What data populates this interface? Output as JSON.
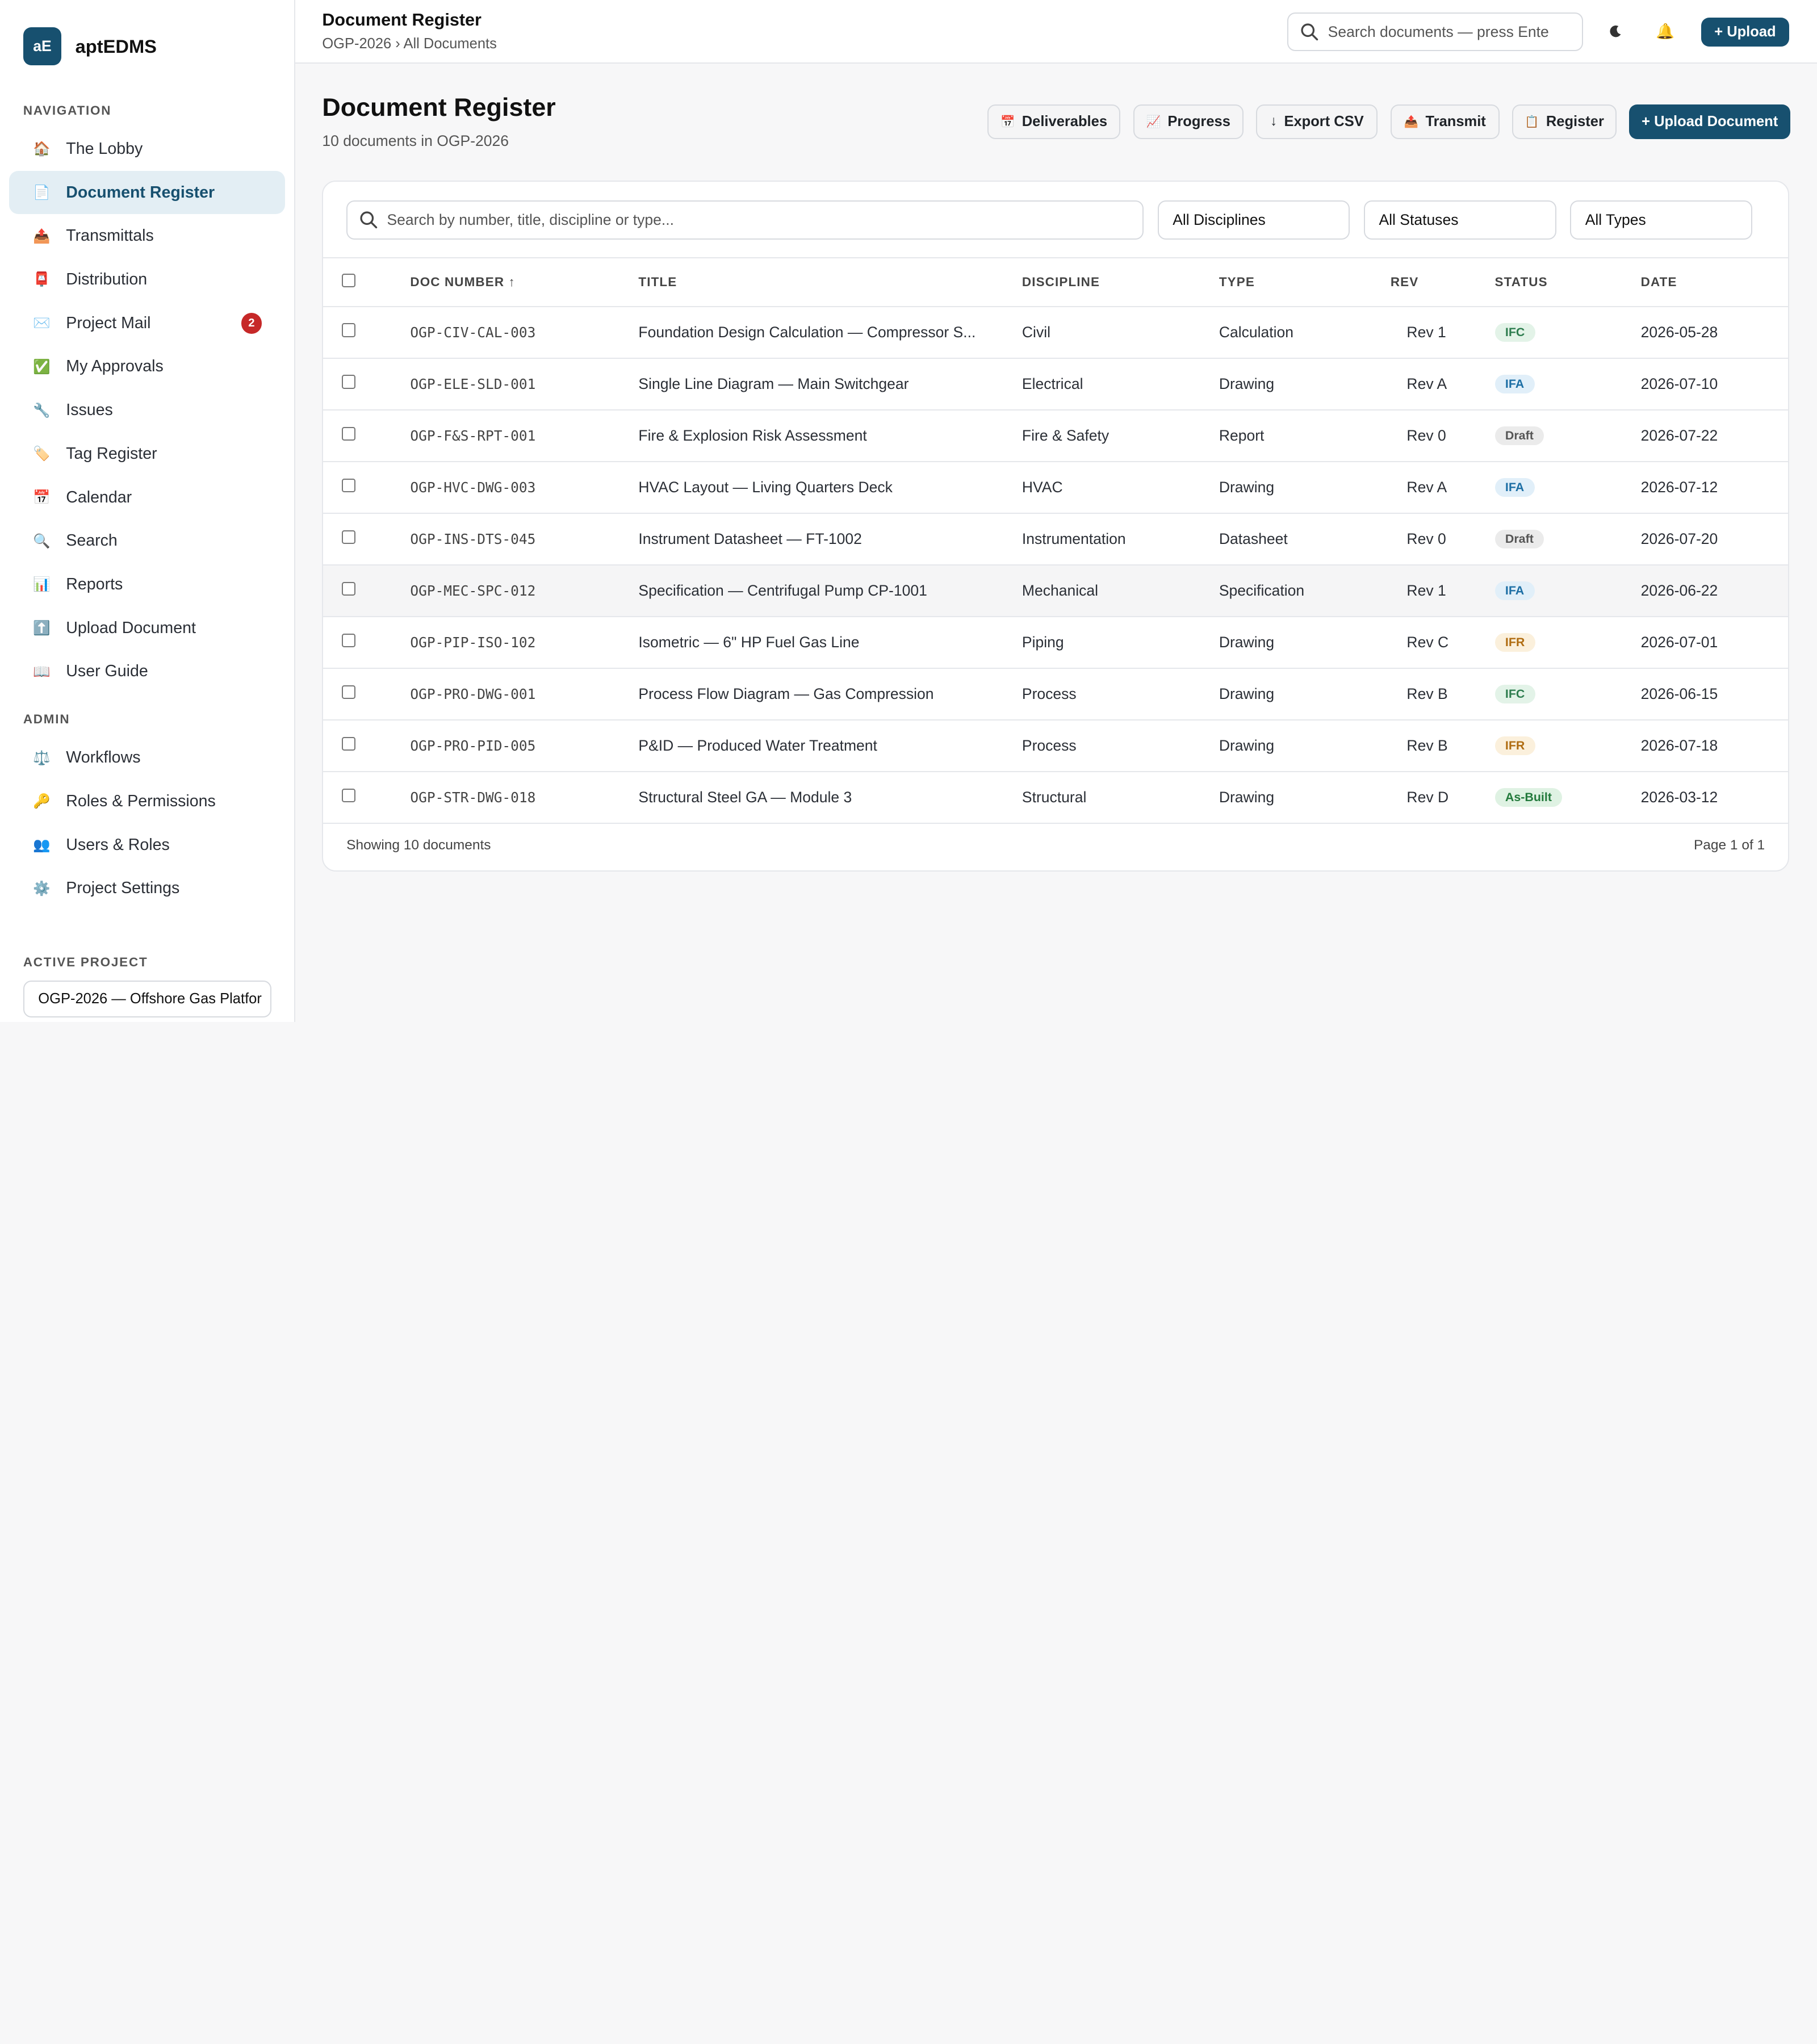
{
  "brand": {
    "logo_text": "aE",
    "name": "aptEDMS"
  },
  "sidebar": {
    "nav_heading": "NAVIGATION",
    "items": [
      {
        "label": "The Lobby",
        "icon": "🏠"
      },
      {
        "label": "Document Register",
        "icon": "📄"
      },
      {
        "label": "Transmittals",
        "icon": "📤"
      },
      {
        "label": "Distribution",
        "icon": "📮"
      },
      {
        "label": "Project Mail",
        "icon": "✉️",
        "badge": "2"
      },
      {
        "label": "My Approvals",
        "icon": "✅"
      },
      {
        "label": "Issues",
        "icon": "🔧"
      },
      {
        "label": "Tag Register",
        "icon": "🏷️"
      },
      {
        "label": "Calendar",
        "icon": "📅"
      },
      {
        "label": "Search",
        "icon": "🔍"
      },
      {
        "label": "Reports",
        "icon": "📊"
      },
      {
        "label": "Upload Document",
        "icon": "⬆️"
      },
      {
        "label": "User Guide",
        "icon": "📖"
      }
    ],
    "admin_heading": "ADMIN",
    "admin_items": [
      {
        "label": "Workflows",
        "icon": "⚖️"
      },
      {
        "label": "Roles & Permissions",
        "icon": "🔑"
      },
      {
        "label": "Users & Roles",
        "icon": "👥"
      },
      {
        "label": "Project Settings",
        "icon": "⚙️"
      }
    ],
    "project_heading": "ACTIVE PROJECT",
    "project_value": "OGP-2026 — Offshore Gas Platfor"
  },
  "topbar": {
    "title": "Document Register",
    "breadcrumb": "OGP-2026 › All Documents",
    "search_placeholder": "Search documents — press Ente",
    "upload_label": "+ Upload"
  },
  "page": {
    "title": "Document Register",
    "subtitle": "10 documents in OGP-2026",
    "actions": [
      {
        "label": "Deliverables",
        "icon": "📅"
      },
      {
        "label": "Progress",
        "icon": "📈"
      },
      {
        "label": "Export CSV",
        "icon": "↓"
      },
      {
        "label": "Transmit",
        "icon": "📤"
      },
      {
        "label": "Register",
        "icon": "📋"
      }
    ],
    "primary_action": "+ Upload Document"
  },
  "filters": {
    "search_placeholder": "Search by number, title, discipline or type...",
    "discipline": "All Disciplines",
    "status": "All Statuses",
    "type": "All Types"
  },
  "table": {
    "columns": [
      "DOC NUMBER ↑",
      "TITLE",
      "DISCIPLINE",
      "TYPE",
      "REV",
      "STATUS",
      "DATE"
    ],
    "rows": [
      {
        "number": "OGP-CIV-CAL-003",
        "title": "Foundation Design Calculation — Compressor S...",
        "discipline": "Civil",
        "type": "Calculation",
        "rev": "Rev 1",
        "status": "IFC",
        "date": "2026-05-28"
      },
      {
        "number": "OGP-ELE-SLD-001",
        "title": "Single Line Diagram — Main Switchgear",
        "discipline": "Electrical",
        "type": "Drawing",
        "rev": "Rev A",
        "status": "IFA",
        "date": "2026-07-10"
      },
      {
        "number": "OGP-F&S-RPT-001",
        "title": "Fire & Explosion Risk Assessment",
        "discipline": "Fire & Safety",
        "type": "Report",
        "rev": "Rev 0",
        "status": "Draft",
        "date": "2026-07-22"
      },
      {
        "number": "OGP-HVC-DWG-003",
        "title": "HVAC Layout — Living Quarters Deck",
        "discipline": "HVAC",
        "type": "Drawing",
        "rev": "Rev A",
        "status": "IFA",
        "date": "2026-07-12"
      },
      {
        "number": "OGP-INS-DTS-045",
        "title": "Instrument Datasheet — FT-1002",
        "discipline": "Instrumentation",
        "type": "Datasheet",
        "rev": "Rev 0",
        "status": "Draft",
        "date": "2026-07-20"
      },
      {
        "number": "OGP-MEC-SPC-012",
        "title": "Specification — Centrifugal Pump CP-1001",
        "discipline": "Mechanical",
        "type": "Specification",
        "rev": "Rev 1",
        "status": "IFA",
        "date": "2026-06-22"
      },
      {
        "number": "OGP-PIP-ISO-102",
        "title": "Isometric — 6\" HP Fuel Gas Line",
        "discipline": "Piping",
        "type": "Drawing",
        "rev": "Rev C",
        "status": "IFR",
        "date": "2026-07-01"
      },
      {
        "number": "OGP-PRO-DWG-001",
        "title": "Process Flow Diagram — Gas Compression",
        "discipline": "Process",
        "type": "Drawing",
        "rev": "Rev B",
        "status": "IFC",
        "date": "2026-06-15"
      },
      {
        "number": "OGP-PRO-PID-005",
        "title": "P&ID — Produced Water Treatment",
        "discipline": "Process",
        "type": "Drawing",
        "rev": "Rev B",
        "status": "IFR",
        "date": "2026-07-18"
      },
      {
        "number": "OGP-STR-DWG-018",
        "title": "Structural Steel GA — Module 3",
        "discipline": "Structural",
        "type": "Drawing",
        "rev": "Rev D",
        "status": "As-Built",
        "date": "2026-03-12"
      }
    ],
    "status_colors": {
      "IFC": {
        "bg": "#e3f3e8",
        "fg": "#2e7d4f"
      },
      "IFA": {
        "bg": "#e1eff9",
        "fg": "#1d6fa5"
      },
      "Draft": {
        "bg": "#ebebeb",
        "fg": "#555555"
      },
      "IFR": {
        "bg": "#fbf0dc",
        "fg": "#b06d12"
      },
      "As-Built": {
        "bg": "#dff2e3",
        "fg": "#237a3c"
      }
    }
  },
  "footer": {
    "left": "Showing 10 documents",
    "right": "Page 1 of 1"
  },
  "colors": {
    "accent": "#17506f",
    "active_nav_bg": "#e3eef4",
    "badge": "#c62828"
  }
}
